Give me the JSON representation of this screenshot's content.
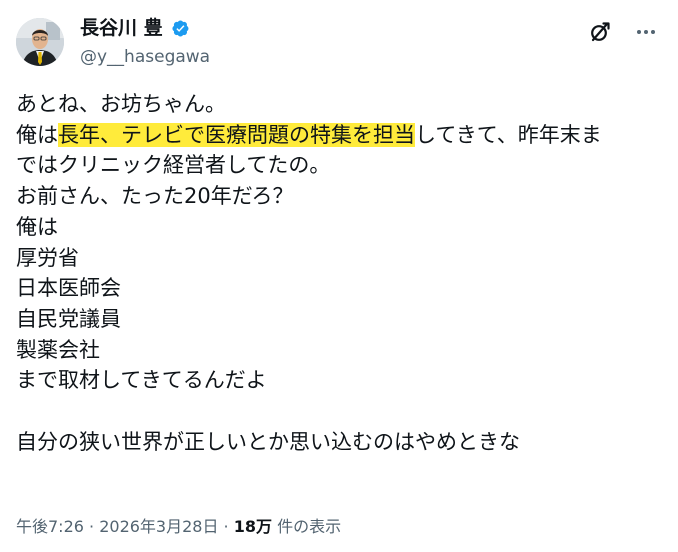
{
  "author": {
    "name": "長谷川 豊",
    "handle": "@y__hasegawa",
    "verified": true
  },
  "actions": {
    "grok_icon": "grok-icon",
    "more_icon": "more-icon"
  },
  "post": {
    "l1": "あとね、お坊ちゃん。",
    "l2_pre": "俺は",
    "l2_mark": "長年、テレビで医療問題の特集を担当",
    "l2_post": "してきて、昨年末ま",
    "l3": "ではクリニック経営者してたの。",
    "l4": "お前さん、たった20年だろ？",
    "l5": "俺は",
    "l6": "厚労省",
    "l7": "日本医師会",
    "l8": "自民党議員",
    "l9": "製薬会社",
    "l10": "まで取材してきてるんだよ",
    "l12": "自分の狭い世界が正しいとか思い込むのはやめときな"
  },
  "meta": {
    "time": "午後7:26",
    "sep1": " · ",
    "date": "2026年3月28日",
    "sep2": " · ",
    "views": "18万",
    "views_label": " 件の表示"
  },
  "colors": {
    "text": "#0f1419",
    "secondary": "#536471",
    "verified": "#1d9bf0",
    "highlight": "#ffeb3b"
  }
}
